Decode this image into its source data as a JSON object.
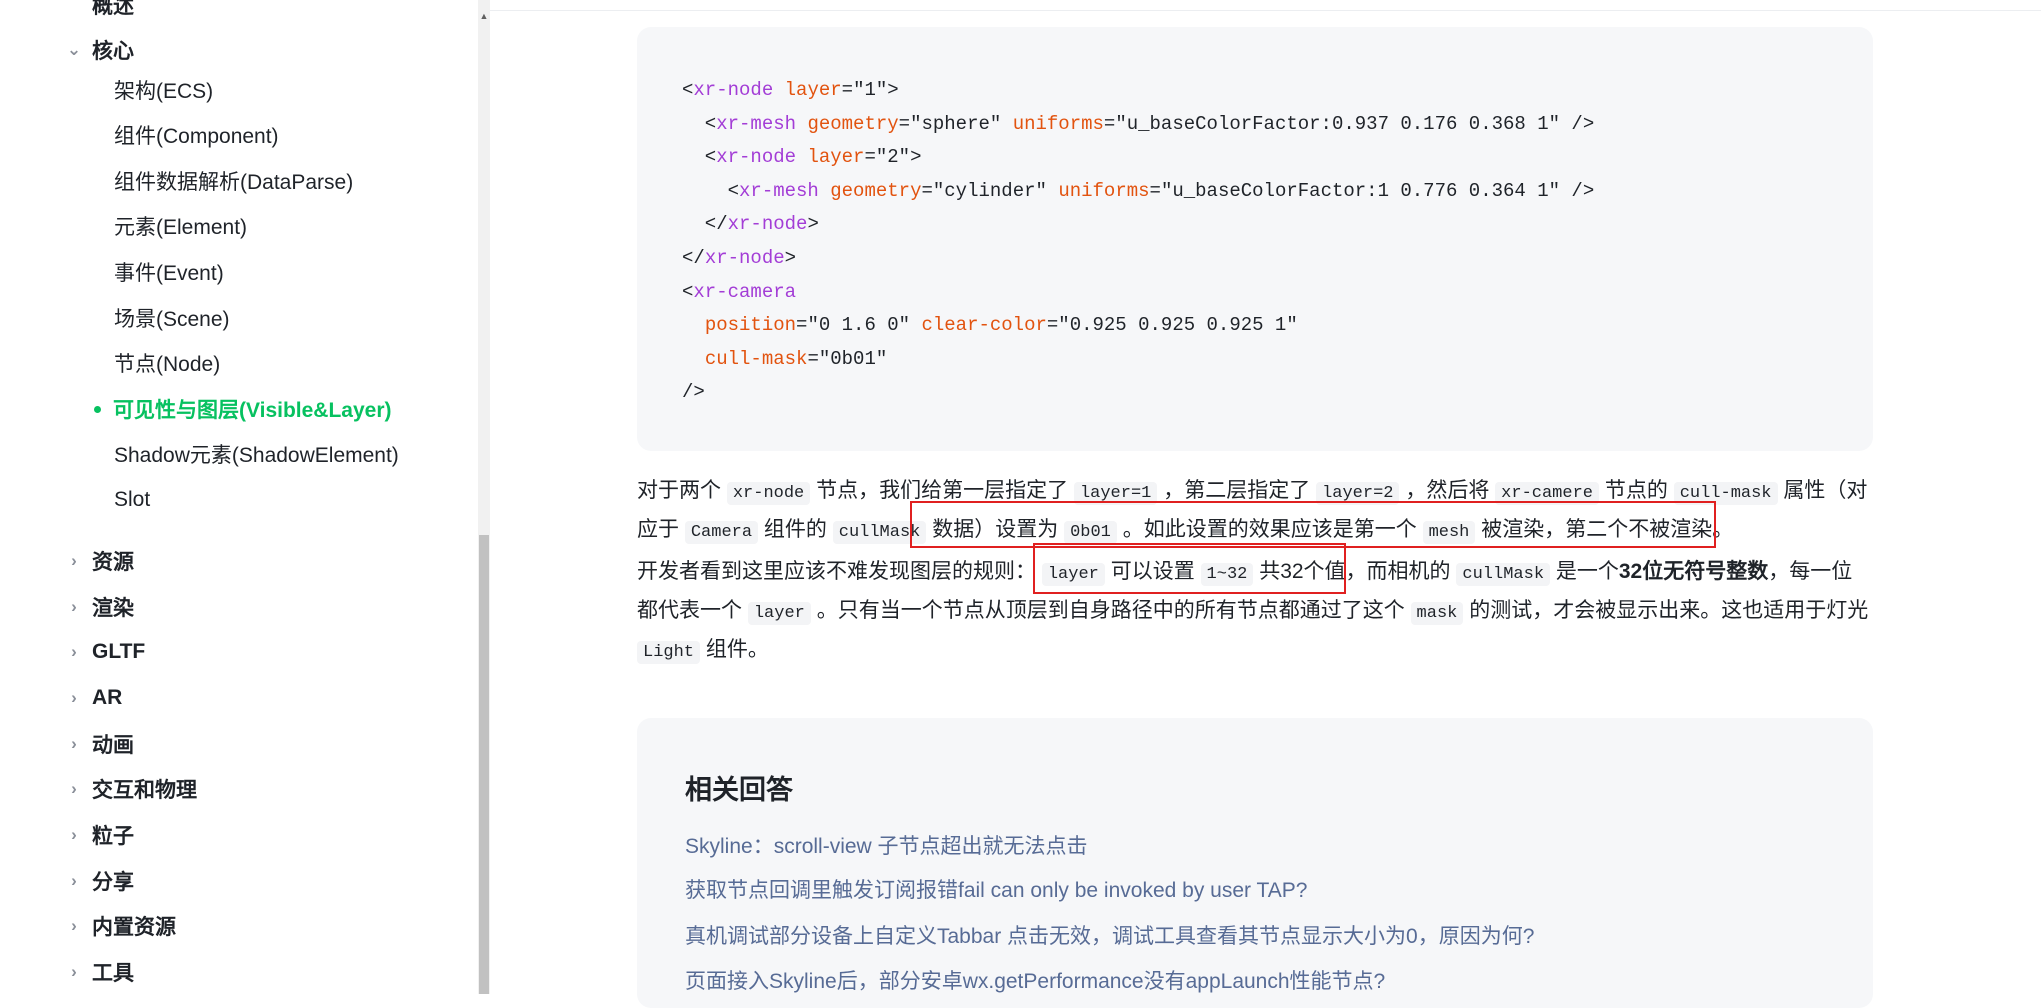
{
  "sidebar": {
    "top_partial": "概述",
    "core": {
      "label": "核心",
      "items": [
        "架构(ECS)",
        "组件(Component)",
        "组件数据解析(DataParse)",
        "元素(Element)",
        "事件(Event)",
        "场景(Scene)",
        "节点(Node)"
      ],
      "active": "可见性与图层(Visible&Layer)",
      "after_active": [
        "Shadow元素(ShadowElement)",
        "Slot"
      ]
    },
    "categories": [
      "资源",
      "渲染",
      "GLTF",
      "AR",
      "动画",
      "交互和物理",
      "粒子",
      "分享",
      "内置资源",
      "工具"
    ]
  },
  "code": {
    "l1_tag": "xr-node",
    "l1_attr": "layer",
    "l1_val": "\"1\"",
    "l2_tag": "xr-mesh",
    "l2_a1": "geometry",
    "l2_v1": "\"sphere\"",
    "l2_a2": "uniforms",
    "l2_v2": "\"u_baseColorFactor:0.937 0.176 0.368 1\"",
    "l3_tag": "xr-node",
    "l3_attr": "layer",
    "l3_val": "\"2\"",
    "l4_tag": "xr-mesh",
    "l4_a1": "geometry",
    "l4_v1": "\"cylinder\"",
    "l4_a2": "uniforms",
    "l4_v2": "\"u_baseColorFactor:1 0.776 0.364 1\"",
    "l5_tag": "xr-node",
    "l6_tag": "xr-node",
    "l7_tag": "xr-camera",
    "l8_a1": "position",
    "l8_v1": "\"0 1.6 0\"",
    "l8_a2": "clear-color",
    "l8_v2": "\"0.925 0.925 0.925 1\"",
    "l9_a1": "cull-mask",
    "l9_v1": "\"0b01\""
  },
  "para1": {
    "t1": "对于两个",
    "c1": "xr-node",
    "t2": "节点，我们给第一层指定了",
    "c2": "layer=1",
    "t3": "，第二层指定了",
    "c3": "layer=2",
    "t4": "，然后将",
    "c4": "xr-camere",
    "t5": "节点的",
    "c5": "cull-mask",
    "t6": "属性（对应于",
    "c6": "Camera",
    "t7": "组件的",
    "c7": "cullMask",
    "t8": "数据）设置为",
    "c8": "0b01",
    "t9": "。如此设置的效果应该是第一个",
    "c9": "mesh",
    "t10": "被渲染，第二个不被渲染。"
  },
  "para2": {
    "t1": "开发者看到这里应该不难发现图层的规则：",
    "c1": "layer",
    "t2": "可以设置",
    "c2": "1~32",
    "t3": "共32个值，而相机的",
    "c3": "cullMask",
    "t4": "是一个",
    "b1": "32位无符号整数",
    "t5": "，每一位都代表一个",
    "c4": "layer",
    "t6": "。只有当一个节点从顶层到自身路径中的所有节点都通过了这个",
    "c5": "mask",
    "t7": "的测试，才会被显示出来。这也适用于灯光",
    "c6": "Light",
    "t8": "组件。"
  },
  "related": {
    "title": "相关回答",
    "links": [
      "Skyline：scroll-view 子节点超出就无法点击",
      "获取节点回调里触发订阅报错fail can only be invoked by user TAP?",
      "真机调试部分设备上自定义Tabbar 点击无效，调试工具查看其节点显示大小为0，原因为何?",
      "页面接入Skyline后，部分安卓wx.getPerformance没有appLaunch性能节点?"
    ]
  },
  "colors": {
    "accent": "#07c160",
    "link": "#576b95",
    "highlight": "#e02020",
    "code_tag": "#a33dd6",
    "code_attr": "#e2530f"
  }
}
